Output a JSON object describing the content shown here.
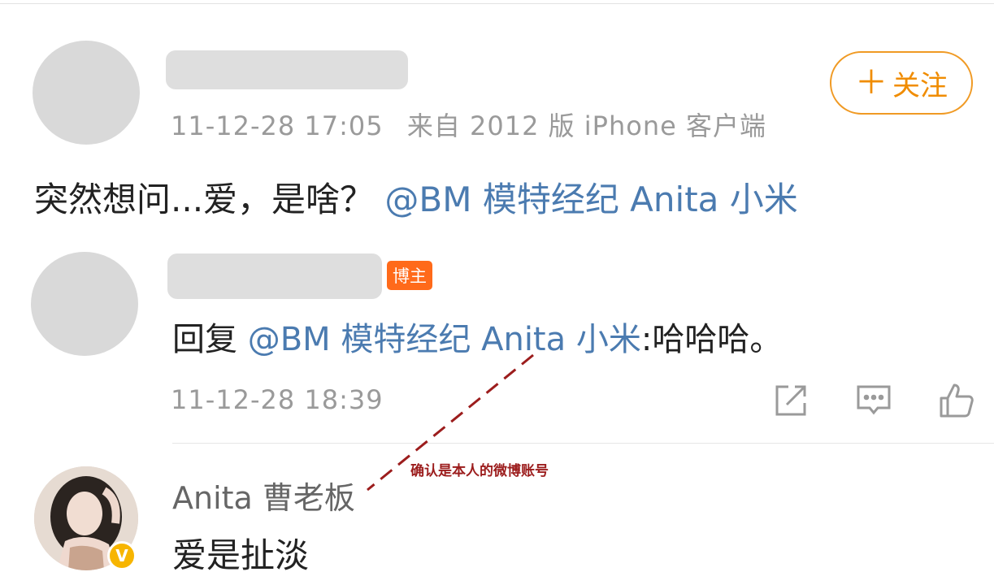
{
  "post": {
    "timestamp": "11-12-28 17:05",
    "source": "来自 2012 版 iPhone 客户端",
    "text_prefix": "突然想问...爱，是啥？",
    "mention": "@BM 模特经纪 Anita 小米"
  },
  "follow_button": {
    "plus": "＋",
    "label": "关注"
  },
  "reply": {
    "badge": "博主",
    "prefix": "回复 ",
    "mention": "@BM 模特经纪 Anita 小米",
    "suffix": ":哈哈哈。",
    "timestamp": "11-12-28 18:39"
  },
  "actions": {
    "icons": [
      "share-icon",
      "comment-icon",
      "like-icon"
    ],
    "icon_color": "#9a9a9a"
  },
  "comment": {
    "username": "Anita 曹老板",
    "text": "爱是扯淡",
    "verified_mark": "V"
  },
  "annotation": {
    "text": "确认是本人的微博账号",
    "color": "#9c1d1d"
  },
  "colors": {
    "accent": "#f08c00",
    "mention": "#4b7bb0",
    "badge": "#ff6a1a"
  }
}
